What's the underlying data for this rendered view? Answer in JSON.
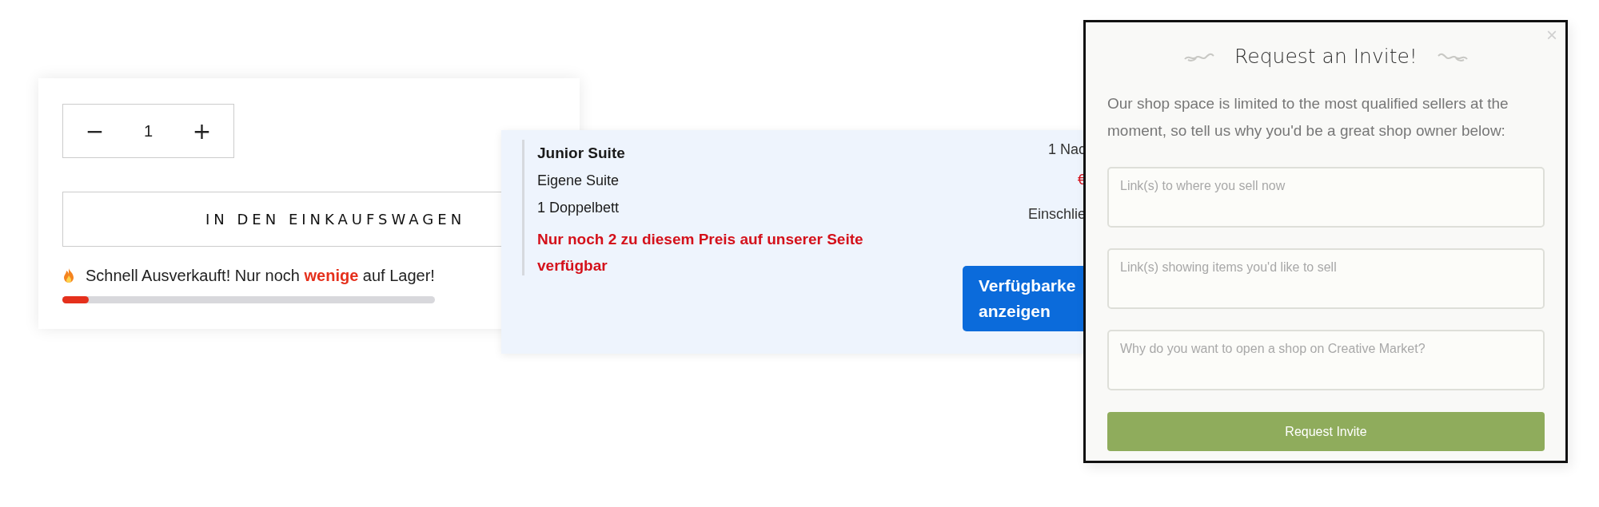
{
  "product_card": {
    "quantity": {
      "minus": "−",
      "value": "1",
      "plus": "+"
    },
    "add_to_cart": "IN DEN EINKAUFSWAGEN",
    "stock_message": "Schnell Ausverkauft! Nur noch **wenige** auf Lager!",
    "stock_bar": {
      "level": 0.07
    }
  },
  "room_card": {
    "title": "Junior Suite",
    "details": [
      "Eigene Suite",
      "1 Doppelbett"
    ],
    "availability_warning": "Nur noch 2 zu diesem Preis auf unserer Seite verfügbar",
    "nights": "1 Nac",
    "old_price": "€",
    "price_note": "Einschlie",
    "button_lines": [
      "Verfügbarke",
      "anzeigen"
    ]
  },
  "invite_modal": {
    "close": "×",
    "title": "Request an Invite!",
    "intro": "Our shop space is limited to the most qualified sellers at the moment, so tell us why you'd be a great shop owner below:",
    "fields": [
      {
        "placeholder": "Link(s) to where you sell now"
      },
      {
        "placeholder": "Link(s) showing items you'd like to sell"
      },
      {
        "placeholder": "Why do you want to open a shop on Creative Market?"
      }
    ],
    "submit": "Request Invite"
  }
}
